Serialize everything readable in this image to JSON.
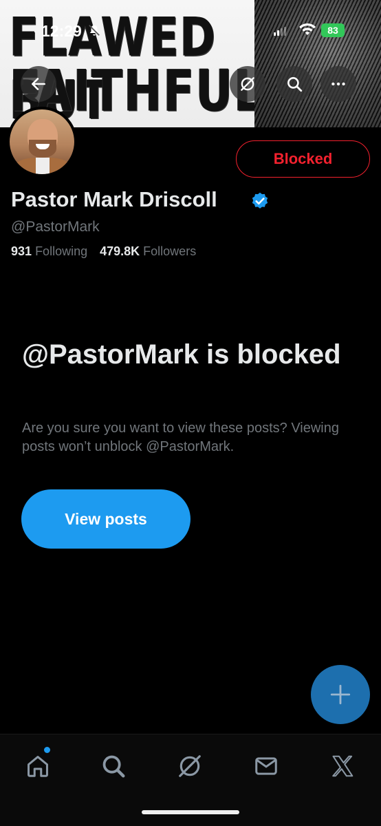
{
  "status_bar": {
    "time": "12:29",
    "battery": "83"
  },
  "banner": {
    "line1": "FLAWED BUT",
    "line2": "FAITHFUL"
  },
  "header": {
    "back_icon": "arrow-left-icon",
    "grok_icon": "grok-icon",
    "search_icon": "search-icon",
    "more_icon": "more-horizontal-icon"
  },
  "profile": {
    "display_name": "Pastor Mark Driscoll",
    "handle": "@PastorMark",
    "following_count": "931",
    "following_label": "Following",
    "followers_count": "479.8K",
    "followers_label": "Followers",
    "blocked_button_label": "Blocked"
  },
  "blocked_notice": {
    "title": "@PastorMark is blocked",
    "description": "Are you sure you want to view these posts? Viewing posts won’t unblock @PastorMark.",
    "button_label": "View posts"
  },
  "bottom_nav": {
    "items": [
      "home-icon",
      "search-icon",
      "grok-icon",
      "messages-icon",
      "x-logo-icon"
    ]
  },
  "colors": {
    "accent": "#1d9bf0",
    "blocked": "#f4212e",
    "background": "#000000",
    "secondary_text": "#71767b"
  }
}
